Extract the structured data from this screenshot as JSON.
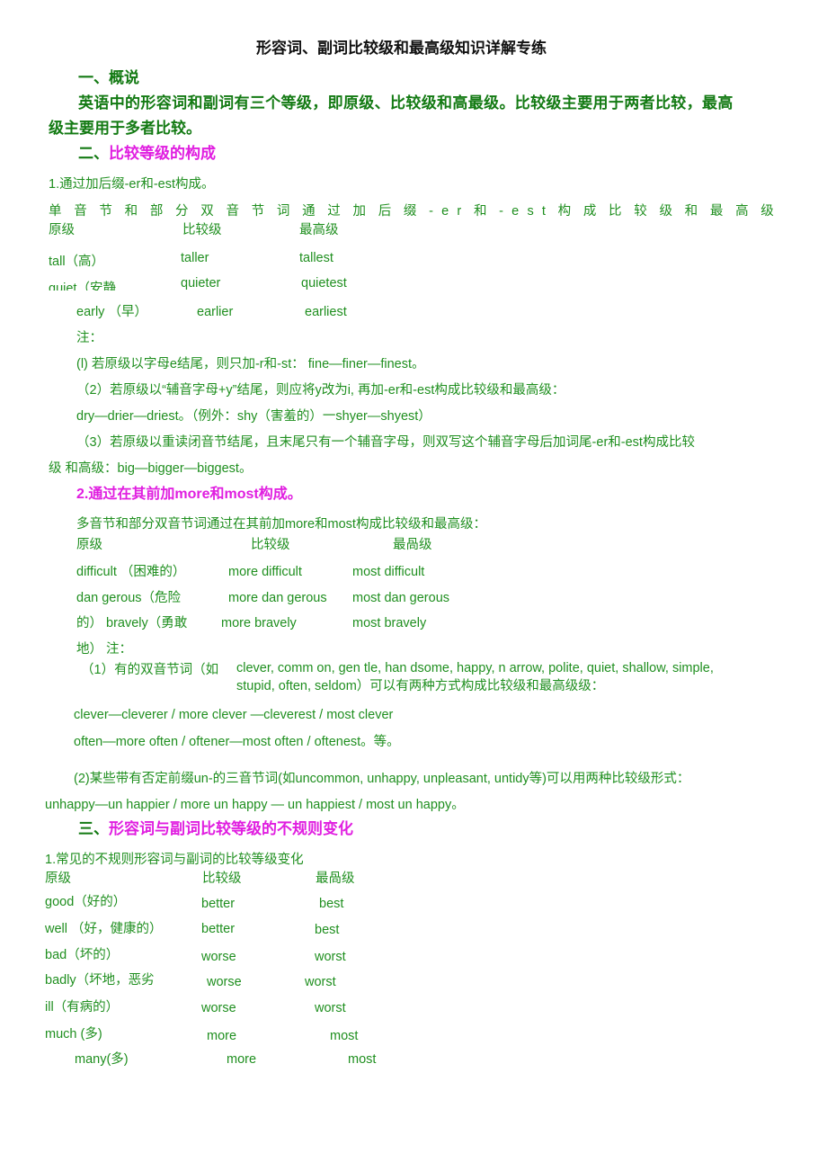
{
  "title": "形容词、副词比较级和最高级知识详解专练",
  "s1": {
    "heading": "一、概说",
    "p1": "英语中的形容词和副词有三个等级，即原级、比较级和高最级。比较级主要用于两者比较，最高",
    "p2": "级主要用于多者比较。"
  },
  "s2": {
    "num": "二、",
    "heading": "比较等级的构成",
    "sub1": "1.通过加后缀-er和-est构成。",
    "spaced": "单音节和部分双音节词通过加后缀-er和-est构成比较级和最高级",
    "headers": [
      "原级",
      "比较级",
      "最高级"
    ],
    "rows1": [
      [
        "tall（高）",
        "taller",
        "tallest"
      ],
      [
        "quiet（安静",
        "quieter",
        "quietest"
      ],
      [
        "early （早）",
        "earlier",
        "earliest"
      ]
    ],
    "note": "注：",
    "n1": "(l) 若原级以字母e结尾，则只加-r和-st： fine—finer—finest。",
    "n2": "（2）若原级以“辅音字母+y”结尾，则应将y改为i, 再加-er和-est构成比较级和最高级：",
    "n2b": "dry—drier—driest。（例外：shy（害羞的）一shyer—shyest）",
    "n3": "（3）若原级以重读闭音节结尾，且末尾只有一个辅音字母，则双写这个辅音字母后加词尾-er和-est构成比较",
    "n3b": "级 和高级：big—bigger—biggest。",
    "sub2": "2.通过在其前加more和most构成。",
    "sub2p": "多音节和部分双音节词通过在其前加more和most构成比较级和最高级：",
    "headers2": [
      "原级",
      "比较级",
      "最咼级"
    ],
    "rows2": [
      [
        "difficult （困难的）",
        "more difficult",
        "most difficult"
      ],
      [
        "dan gerous（危险",
        "more dan gerous",
        "most dan gerous"
      ],
      [
        "的） bravely（勇敢",
        "more bravely",
        "most bravely"
      ]
    ],
    "note2": "地） 注：",
    "m1a": "（1）有的双音节词（如",
    "m1b": "clever, comm on, gen tle, han dsome, happy, n arrow, polite, quiet, shallow, simple,",
    "m1c": "stupid,   often, seldom）可以有两种方式构成比较级和最高级级：",
    "ex1": "clever—cleverer / more clever —cleverest / most clever",
    "ex2": "often—more often / oftener—most often / oftenest。等。",
    "m2": "(2)某些带有否定前缀un-的三音节词(如uncommon, unhappy, unpleasant, untidy等)可以用两种比较级形式：",
    "m2b": "unhappy—un happier / more un happy — un happiest / most un happy。"
  },
  "s3": {
    "num": "三、",
    "heading": "形容词与副词比较等级的不规则变化",
    "sub1": "1.常见的不规则形容词与副词的比较等级变化",
    "headers": [
      "原级",
      "比较级",
      "最咼级"
    ],
    "rows": [
      [
        "good（好的）",
        "better",
        "best"
      ],
      [
        "well （好，健康的）",
        "better",
        "best"
      ],
      [
        "bad（坏的）",
        "worse",
        "worst"
      ],
      [
        "badly（坏地，恶劣",
        "worse",
        "worst"
      ],
      [
        "ill（有病的）",
        "worse",
        "worst"
      ],
      [
        "much (多)",
        "more",
        "most"
      ],
      [
        "many(多)",
        "more",
        "most"
      ]
    ]
  },
  "colors": {
    "green": "#1f8f1f",
    "heading_green": "#137a13",
    "magenta": "#e01ee0"
  }
}
